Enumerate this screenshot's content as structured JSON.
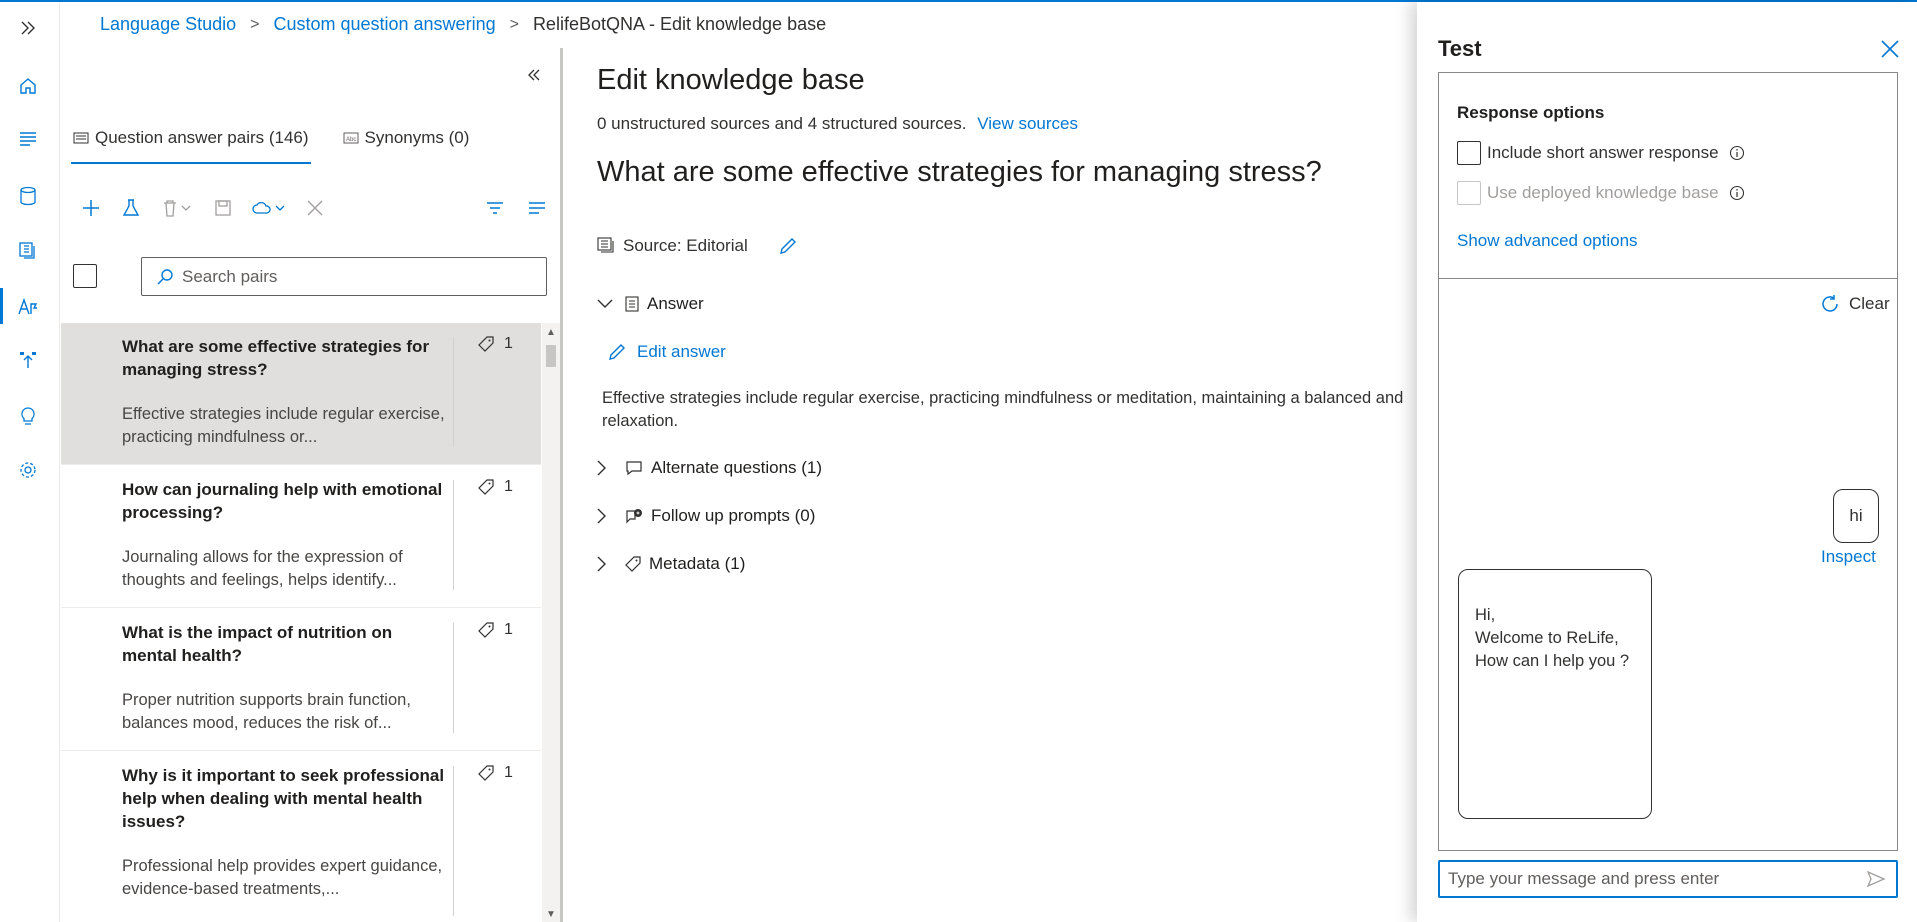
{
  "breadcrumb": {
    "items": [
      "Language Studio",
      "Custom question answering"
    ],
    "current": "RelifeBotQNA - Edit knowledge base"
  },
  "rail": {
    "icons": [
      "expand-icon",
      "home-icon",
      "lines-icon",
      "database-icon",
      "documents-icon",
      "qa-icon",
      "deploy-icon",
      "lightbulb-icon",
      "settings-icon"
    ]
  },
  "list_panel": {
    "tabs": [
      {
        "label": "Question answer pairs (146)",
        "active": true
      },
      {
        "label": "Synonyms (0)",
        "active": false
      }
    ],
    "search": {
      "placeholder": "Search pairs",
      "value": ""
    },
    "pairs": [
      {
        "question": "What are some effective strategies for managing stress?",
        "answer": "Effective strategies include regular exercise, practicing mindfulness or...",
        "tags": "1",
        "selected": true
      },
      {
        "question": "How can journaling help with emotional processing?",
        "answer": "Journaling allows for the expression of thoughts and feelings, helps identify...",
        "tags": "1",
        "selected": false
      },
      {
        "question": "What is the impact of nutrition on mental health?",
        "answer": "Proper nutrition supports brain function, balances mood, reduces the risk of...",
        "tags": "1",
        "selected": false
      },
      {
        "question": "Why is it important to seek professional help when dealing with mental health issues?",
        "answer": "Professional help provides expert guidance, evidence-based treatments,...",
        "tags": "1",
        "selected": false
      }
    ]
  },
  "main": {
    "title": "Edit knowledge base",
    "sources_text": "0 unstructured sources and 4 structured sources.",
    "view_sources": "View sources",
    "question": "What are some effective strategies for managing stress?",
    "source": "Source: Editorial",
    "answer_label": "Answer",
    "edit_answer": "Edit answer",
    "answer_text": "Effective strategies include regular exercise, practicing mindfulness or meditation, maintaining a balanced and relaxation.",
    "alternate_questions": "Alternate questions (1)",
    "follow_up_prompts": "Follow up prompts (0)",
    "metadata": "Metadata (1)"
  },
  "test_panel": {
    "title": "Test",
    "response_options": "Response options",
    "include_short_answer": "Include short answer response",
    "use_deployed": "Use deployed knowledge base",
    "show_advanced": "Show advanced options",
    "clear": "Clear",
    "user_message": "hi",
    "inspect": "Inspect",
    "bot_message": "Hi,\nWelcome to ReLife,\nHow can I help you ?",
    "input_placeholder": "Type your message and press enter",
    "input_value": ""
  },
  "colors": {
    "accent": "#0078d4",
    "selected_row": "#e1dfdd"
  }
}
